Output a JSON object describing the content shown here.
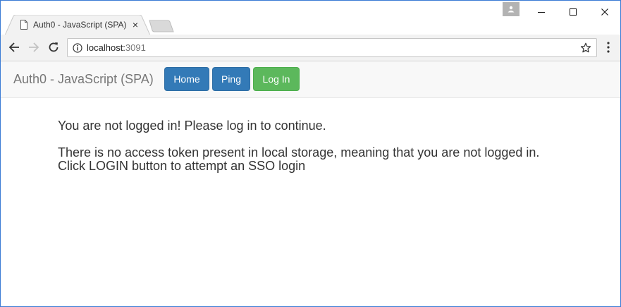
{
  "browser": {
    "tab_title": "Auth0 - JavaScript (SPA)",
    "tab_close": "×",
    "url_host": "localhost:",
    "url_port": "3091",
    "icons": {
      "tab": "document-icon",
      "back": "arrow-left-icon",
      "forward": "arrow-right-icon",
      "reload": "reload-icon",
      "info": "info-icon",
      "bookmark": "star-icon",
      "menu": "kebab-menu-icon",
      "user": "user-icon",
      "minimize": "minimize-icon",
      "maximize": "maximize-icon",
      "close": "close-icon"
    }
  },
  "navbar": {
    "brand": "Auth0 - JavaScript (SPA)",
    "home_label": "Home",
    "ping_label": "Ping",
    "login_label": "Log In",
    "colors": {
      "primary": "#337ab7",
      "success": "#5cb85c"
    }
  },
  "content": {
    "not_logged_in": "You are not logged in! Please log in to continue.",
    "no_token": "There is no access token present in local storage, meaning that you are not logged in.",
    "sso_hint": "Click LOGIN button to attempt an SSO login"
  }
}
